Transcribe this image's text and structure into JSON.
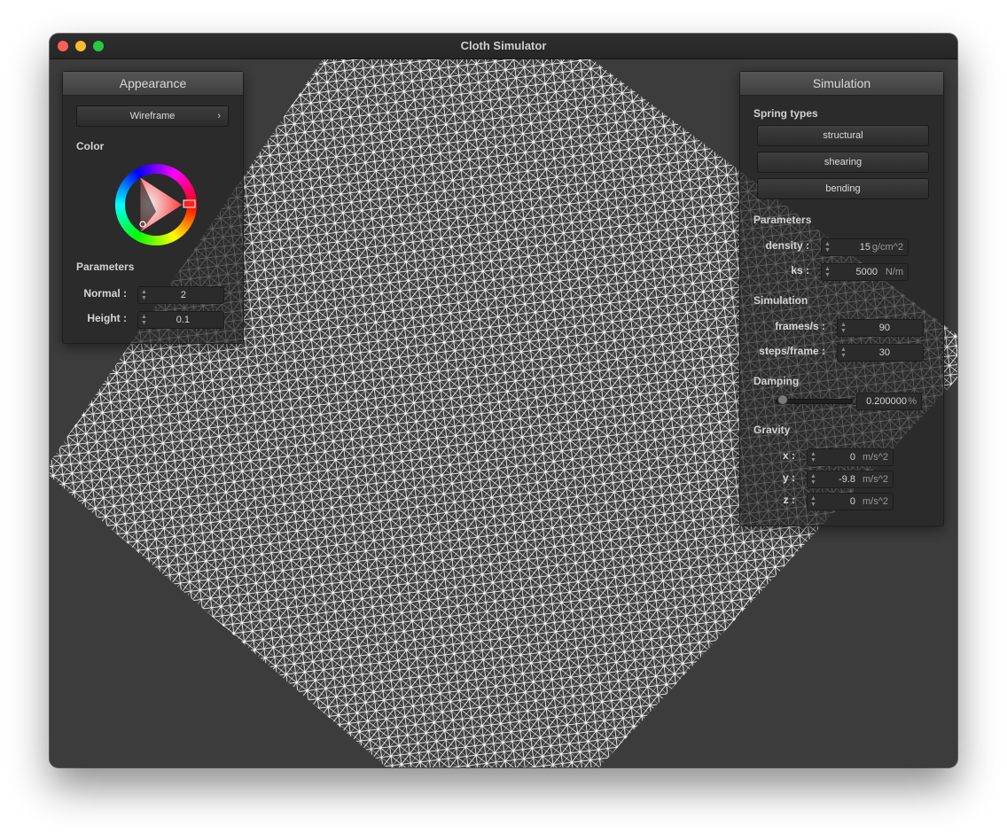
{
  "window": {
    "title": "Cloth Simulator"
  },
  "appearance_panel": {
    "header": "Appearance",
    "shader_dropdown": {
      "selected": "Wireframe",
      "chevron": "›"
    },
    "color_label": "Color",
    "parameters_label": "Parameters",
    "normal": {
      "label": "Normal :",
      "value": "2"
    },
    "height": {
      "label": "Height :",
      "value": "0.1"
    }
  },
  "simulation_panel": {
    "header": "Simulation",
    "spring_types_label": "Spring types",
    "spring_buttons": [
      "structural",
      "shearing",
      "bending"
    ],
    "parameters_label": "Parameters",
    "density": {
      "label": "density :",
      "value": "15",
      "unit": "g/cm^2"
    },
    "ks": {
      "label": "ks :",
      "value": "5000",
      "unit": "N/m"
    },
    "simulation_label": "Simulation",
    "fps": {
      "label": "frames/s :",
      "value": "90"
    },
    "steps": {
      "label": "steps/frame :",
      "value": "30"
    },
    "damping_label": "Damping",
    "damping": {
      "value": "0.200000",
      "unit": "%",
      "slider_level": 0.02
    },
    "gravity_label": "Gravity",
    "gravity": {
      "x": {
        "label": "x :",
        "value": "0",
        "unit": "m/s^2"
      },
      "y": {
        "label": "y :",
        "value": "-9.8",
        "unit": "m/s^2"
      },
      "z": {
        "label": "z :",
        "value": "0",
        "unit": "m/s^2"
      }
    }
  },
  "colors": {
    "background": "#3c3c3c",
    "wire": "#ffffff",
    "selected_hue": "#ff0000"
  },
  "icons": {
    "close": "close-traffic-light-icon",
    "minimize": "minimize-traffic-light-icon",
    "maximize": "maximize-traffic-light-icon",
    "spinner": "spinner-arrows-icon",
    "color_wheel": "color-wheel-icon"
  }
}
